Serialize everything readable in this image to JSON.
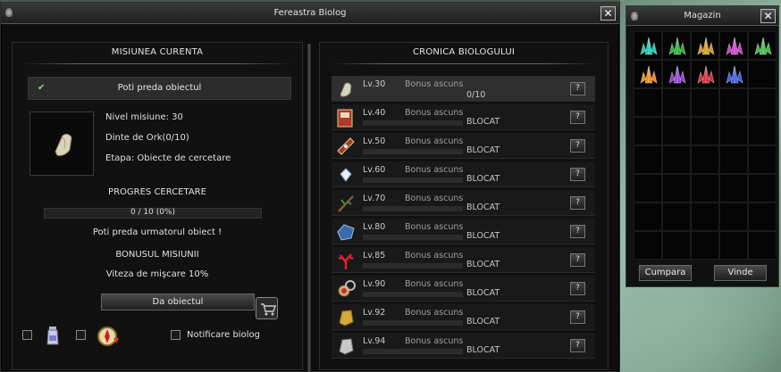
{
  "biolog": {
    "title": "Fereastra Biolog",
    "current": {
      "header": "MISIUNEA CURENTA",
      "status": "Poti preda obiectul",
      "level_line": "Nivel misiune: 30",
      "item_line": "Dinte de Ork(0/10)",
      "stage_line": "Etapa: Obiecte de cercetare",
      "progress_header": "PROGRES CERCETARE",
      "progress_text": "0 / 10  (0%)",
      "progress_fraction": 0,
      "next_text": "Poti preda urmatorul obiect !",
      "bonus_header": "BONUSUL MISIUNII",
      "bonus_text": "Viteza de mişcare 10%",
      "give_button": "Da obiectul",
      "notify_label": "Notificare biolog"
    },
    "chronicle": {
      "header": "CRONICA BIOLOGULUI",
      "rows": [
        {
          "level": "Lv.30",
          "bonus": "Bonus ascuns",
          "status": "0/10",
          "icon": "ork-tooth-icon"
        },
        {
          "level": "Lv.40",
          "bonus": "Bonus ascuns",
          "status": "BLOCAT",
          "icon": "book-icon"
        },
        {
          "level": "Lv.50",
          "bonus": "Bonus ascuns",
          "status": "BLOCAT",
          "icon": "scroll-icon"
        },
        {
          "level": "Lv.60",
          "bonus": "Bonus ascuns",
          "status": "BLOCAT",
          "icon": "crystal-icon"
        },
        {
          "level": "Lv.70",
          "bonus": "Bonus ascuns",
          "status": "BLOCAT",
          "icon": "branch-icon"
        },
        {
          "level": "Lv.80",
          "bonus": "Bonus ascuns",
          "status": "BLOCAT",
          "icon": "blue-rock-icon"
        },
        {
          "level": "Lv.85",
          "bonus": "Bonus ascuns",
          "status": "BLOCAT",
          "icon": "red-coral-icon"
        },
        {
          "level": "Lv.90",
          "bonus": "Bonus ascuns",
          "status": "BLOCAT",
          "icon": "amulet-icon"
        },
        {
          "level": "Lv.92",
          "bonus": "Bonus ascuns",
          "status": "BLOCAT",
          "icon": "gold-stone-icon"
        },
        {
          "level": "Lv.94",
          "bonus": "Bonus ascuns",
          "status": "BLOCAT",
          "icon": "silver-stone-icon"
        }
      ],
      "help_label": "?"
    }
  },
  "shop": {
    "title": "Magazin",
    "buy_button": "Cumpara",
    "sell_button": "Vinde",
    "items": [
      "#19c9b6",
      "#27b23a",
      "#d39b1c",
      "#d23bd0",
      "#3dc23f",
      "#f08a1c",
      "#9a3ae0",
      "#e0283a",
      "#3a5ae8"
    ]
  },
  "close_glyph": "✕"
}
